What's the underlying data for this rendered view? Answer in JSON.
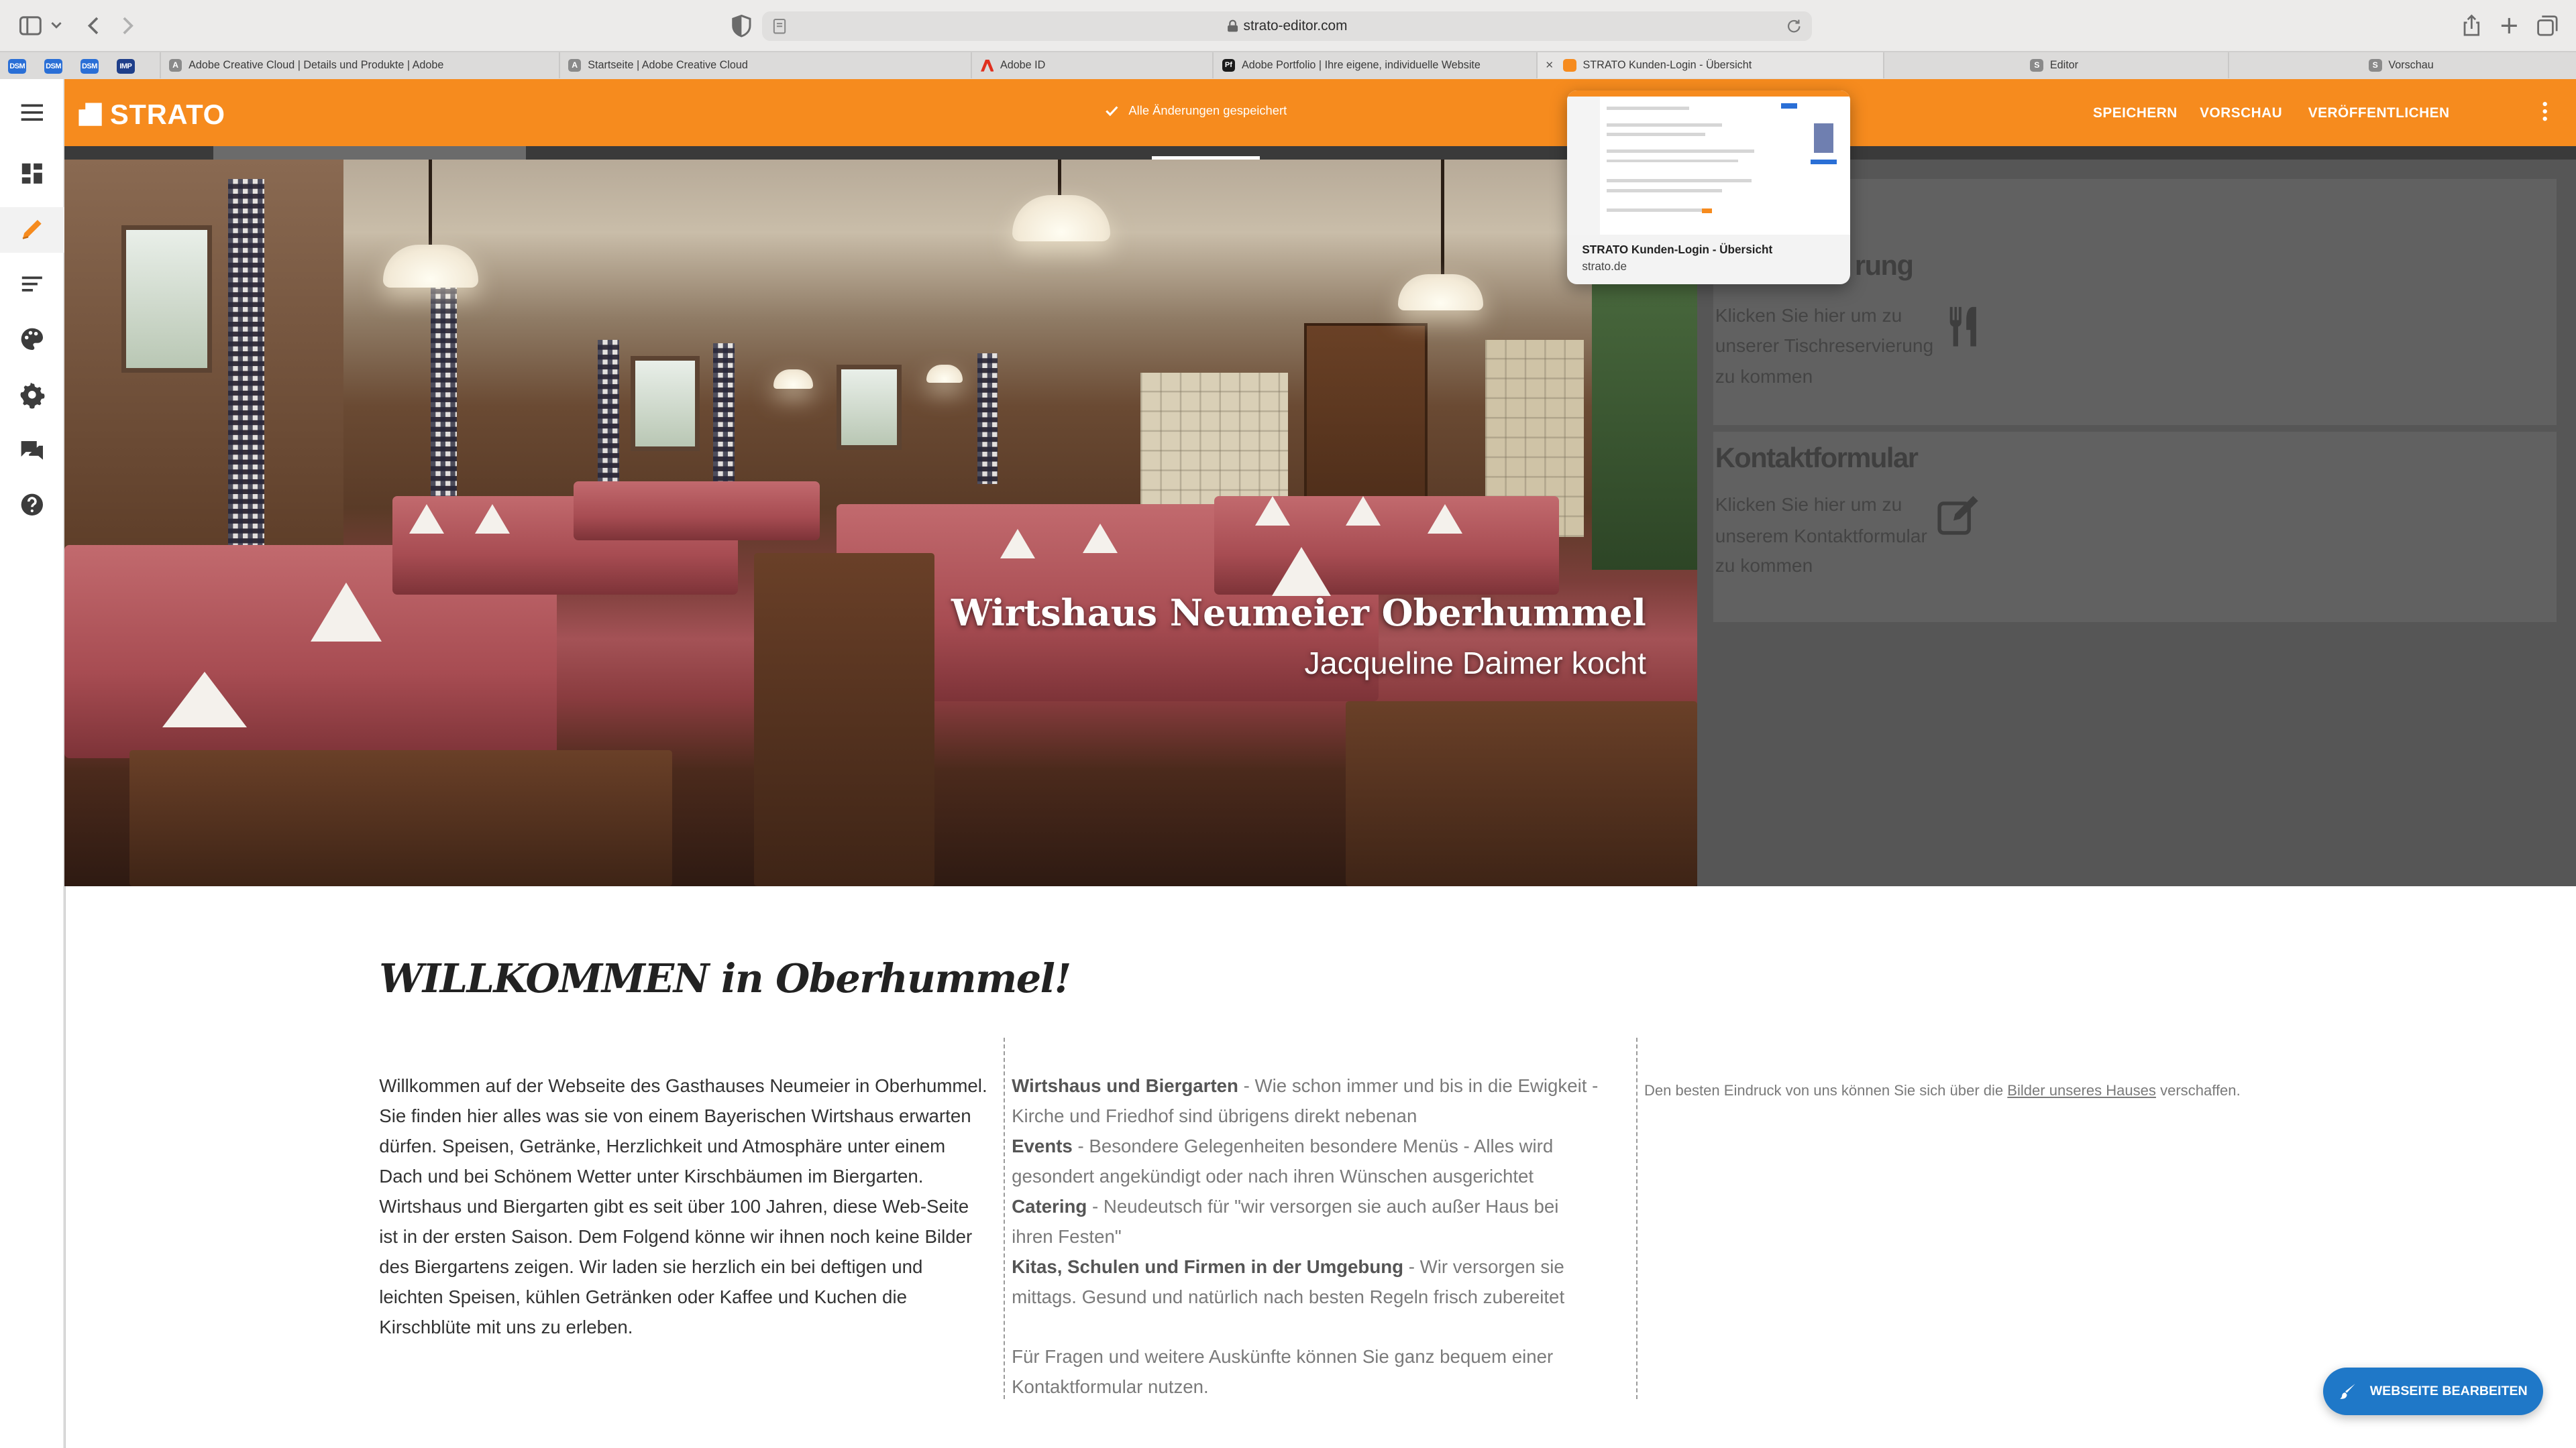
{
  "browser": {
    "url": "strato-editor.com",
    "favorites": [
      "DSM",
      "DSM",
      "DSM",
      "IMP"
    ],
    "tabs": [
      {
        "label": "Adobe Creative Cloud | Details und Produkte | Adobe",
        "favicon": "A",
        "color": "#8a8a8a"
      },
      {
        "label": "Startseite | Adobe Creative Cloud",
        "favicon": "A",
        "color": "#8a8a8a"
      },
      {
        "label": "Adobe ID",
        "favicon": "A",
        "color": "#e0301e"
      },
      {
        "label": "Adobe Portfolio | Ihre eigene, individuelle Website",
        "favicon": "Pf",
        "color": "#1b1b1b"
      },
      {
        "label": "STRATO Kunden-Login - Übersicht",
        "favicon": "",
        "color": "#f68b1e",
        "active": true
      },
      {
        "label": "Editor",
        "favicon": "S",
        "color": "#8a8a8a"
      },
      {
        "label": "Vorschau",
        "favicon": "S",
        "color": "#8a8a8a"
      }
    ]
  },
  "editor": {
    "logo": "STRATO",
    "save_status": "Alle Änderungen gespeichert",
    "save_label": "SPEICHERN",
    "preview_label": "VORSCHAU",
    "publish_label": "VERÖFFENTLICHEN",
    "accent_color": "#f68b1e",
    "left_toolbar_icons": [
      "menu-icon",
      "dashboard-icon",
      "pencil-icon",
      "text-lines-icon",
      "palette-icon",
      "gear-icon",
      "chat-icon",
      "help-icon"
    ]
  },
  "tab_preview": {
    "title": "STRATO Kunden-Login - Übersicht",
    "host": "strato.de"
  },
  "hero": {
    "title": "Wirtshaus Neumeier Oberhummel",
    "subtitle": "Jacqueline Daimer kocht",
    "cards": [
      {
        "title": "rung",
        "lines": [
          "Klicken Sie hier um zu",
          "unserer Tischreservierung",
          "zu kommen"
        ],
        "icon": "fork-knife-icon"
      },
      {
        "title": "Kontaktformular",
        "lines": [
          "Klicken Sie hier um zu",
          "unserem Kontaktformular",
          "zu kommen"
        ],
        "icon": "edit-icon"
      }
    ]
  },
  "content": {
    "heading": "WILLKOMMEN in Oberhummel!",
    "intro": "Willkommen auf der Webseite des Gasthauses Neumeier in Oberhummel. Sie finden hier alles was sie von einem Bayerischen Wirtshaus erwarten dürfen. Speisen, Getränke, Herzlichkeit und Atmosphäre unter einem Dach und bei Schönem Wetter unter Kirschbäumen im Biergarten. Wirtshaus und Biergarten gibt es seit über 100 Jahren, diese Web-Seite ist in der ersten Saison. Dem Folgend könne wir ihnen noch keine Bilder des Biergartens zeigen. Wir laden sie herzlich ein bei deftigen und leichten Speisen, kühlen Getränken oder Kaffee und Kuchen die Kirschblüte mit uns zu erleben.",
    "offers": [
      {
        "bold": "Wirtshaus und Biergarten",
        "text": " - Wie schon immer und bis in die Ewigkeit - Kirche und Friedhof sind übrigens direkt nebenan"
      },
      {
        "bold": "Events",
        "text": " - Besondere Gelegenheiten besondere Menüs - Alles wird gesondert angekündigt oder nach ihren Wünschen ausgerichtet"
      },
      {
        "bold": "Catering",
        "text": " - Neudeutsch für \"wir versorgen sie auch außer Haus bei ihren Festen\""
      },
      {
        "bold": "Kitas, Schulen und Firmen in der Umgebung",
        "text": " - Wir versorgen sie mittags. Gesund und natürlich nach besten Regeln frisch zubereitet"
      }
    ],
    "contact_note": "Für Fragen und weitere Auskünfte können Sie ganz bequem einer Kontaktformular nutzen.",
    "gallery_note": [
      {
        "text": "Den besten Eindruck von uns können Sie sich über die "
      },
      {
        "text": "Bilder unseres Hauses",
        "link": true
      },
      {
        "text": " verschaffen."
      }
    ]
  },
  "edit_button": {
    "label": "WEBSEITE BEARBEITEN",
    "color": "#1f78c8"
  }
}
